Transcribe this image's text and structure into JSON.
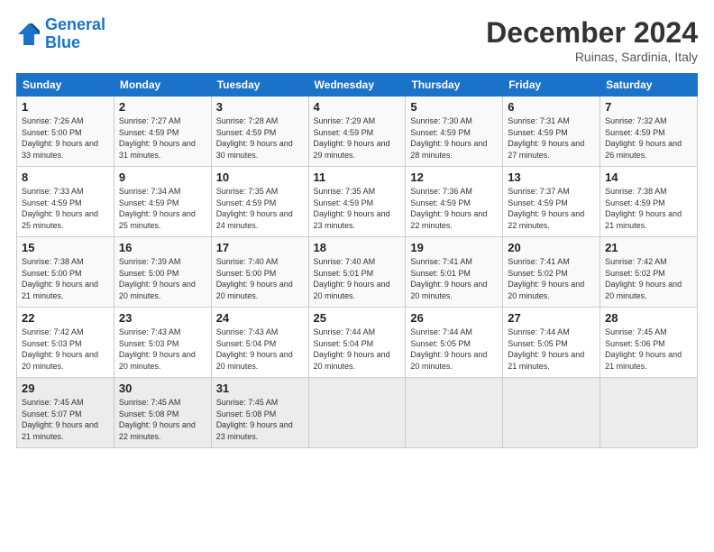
{
  "header": {
    "logo_line1": "General",
    "logo_line2": "Blue",
    "month_title": "December 2024",
    "location": "Ruinas, Sardinia, Italy"
  },
  "days_of_week": [
    "Sunday",
    "Monday",
    "Tuesday",
    "Wednesday",
    "Thursday",
    "Friday",
    "Saturday"
  ],
  "weeks": [
    [
      {
        "day": "1",
        "sunrise": "7:26 AM",
        "sunset": "5:00 PM",
        "daylight": "9 hours and 33 minutes."
      },
      {
        "day": "2",
        "sunrise": "7:27 AM",
        "sunset": "4:59 PM",
        "daylight": "9 hours and 31 minutes."
      },
      {
        "day": "3",
        "sunrise": "7:28 AM",
        "sunset": "4:59 PM",
        "daylight": "9 hours and 30 minutes."
      },
      {
        "day": "4",
        "sunrise": "7:29 AM",
        "sunset": "4:59 PM",
        "daylight": "9 hours and 29 minutes."
      },
      {
        "day": "5",
        "sunrise": "7:30 AM",
        "sunset": "4:59 PM",
        "daylight": "9 hours and 28 minutes."
      },
      {
        "day": "6",
        "sunrise": "7:31 AM",
        "sunset": "4:59 PM",
        "daylight": "9 hours and 27 minutes."
      },
      {
        "day": "7",
        "sunrise": "7:32 AM",
        "sunset": "4:59 PM",
        "daylight": "9 hours and 26 minutes."
      }
    ],
    [
      {
        "day": "8",
        "sunrise": "7:33 AM",
        "sunset": "4:59 PM",
        "daylight": "9 hours and 25 minutes."
      },
      {
        "day": "9",
        "sunrise": "7:34 AM",
        "sunset": "4:59 PM",
        "daylight": "9 hours and 25 minutes."
      },
      {
        "day": "10",
        "sunrise": "7:35 AM",
        "sunset": "4:59 PM",
        "daylight": "9 hours and 24 minutes."
      },
      {
        "day": "11",
        "sunrise": "7:35 AM",
        "sunset": "4:59 PM",
        "daylight": "9 hours and 23 minutes."
      },
      {
        "day": "12",
        "sunrise": "7:36 AM",
        "sunset": "4:59 PM",
        "daylight": "9 hours and 22 minutes."
      },
      {
        "day": "13",
        "sunrise": "7:37 AM",
        "sunset": "4:59 PM",
        "daylight": "9 hours and 22 minutes."
      },
      {
        "day": "14",
        "sunrise": "7:38 AM",
        "sunset": "4:59 PM",
        "daylight": "9 hours and 21 minutes."
      }
    ],
    [
      {
        "day": "15",
        "sunrise": "7:38 AM",
        "sunset": "5:00 PM",
        "daylight": "9 hours and 21 minutes."
      },
      {
        "day": "16",
        "sunrise": "7:39 AM",
        "sunset": "5:00 PM",
        "daylight": "9 hours and 20 minutes."
      },
      {
        "day": "17",
        "sunrise": "7:40 AM",
        "sunset": "5:00 PM",
        "daylight": "9 hours and 20 minutes."
      },
      {
        "day": "18",
        "sunrise": "7:40 AM",
        "sunset": "5:01 PM",
        "daylight": "9 hours and 20 minutes."
      },
      {
        "day": "19",
        "sunrise": "7:41 AM",
        "sunset": "5:01 PM",
        "daylight": "9 hours and 20 minutes."
      },
      {
        "day": "20",
        "sunrise": "7:41 AM",
        "sunset": "5:02 PM",
        "daylight": "9 hours and 20 minutes."
      },
      {
        "day": "21",
        "sunrise": "7:42 AM",
        "sunset": "5:02 PM",
        "daylight": "9 hours and 20 minutes."
      }
    ],
    [
      {
        "day": "22",
        "sunrise": "7:42 AM",
        "sunset": "5:03 PM",
        "daylight": "9 hours and 20 minutes."
      },
      {
        "day": "23",
        "sunrise": "7:43 AM",
        "sunset": "5:03 PM",
        "daylight": "9 hours and 20 minutes."
      },
      {
        "day": "24",
        "sunrise": "7:43 AM",
        "sunset": "5:04 PM",
        "daylight": "9 hours and 20 minutes."
      },
      {
        "day": "25",
        "sunrise": "7:44 AM",
        "sunset": "5:04 PM",
        "daylight": "9 hours and 20 minutes."
      },
      {
        "day": "26",
        "sunrise": "7:44 AM",
        "sunset": "5:05 PM",
        "daylight": "9 hours and 20 minutes."
      },
      {
        "day": "27",
        "sunrise": "7:44 AM",
        "sunset": "5:05 PM",
        "daylight": "9 hours and 21 minutes."
      },
      {
        "day": "28",
        "sunrise": "7:45 AM",
        "sunset": "5:06 PM",
        "daylight": "9 hours and 21 minutes."
      }
    ],
    [
      {
        "day": "29",
        "sunrise": "7:45 AM",
        "sunset": "5:07 PM",
        "daylight": "9 hours and 21 minutes."
      },
      {
        "day": "30",
        "sunrise": "7:45 AM",
        "sunset": "5:08 PM",
        "daylight": "9 hours and 22 minutes."
      },
      {
        "day": "31",
        "sunrise": "7:45 AM",
        "sunset": "5:08 PM",
        "daylight": "9 hours and 23 minutes."
      },
      null,
      null,
      null,
      null
    ]
  ]
}
